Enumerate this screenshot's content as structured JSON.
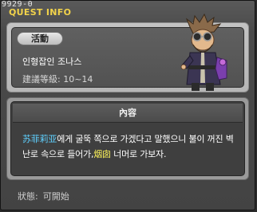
{
  "quest_id": "9929-0",
  "window_title": "QUEST INFO",
  "tag_label": "活動",
  "npc_name": "인형잡인 조나스",
  "level_label": "建議等級:",
  "level_range": "10~14",
  "content_header": "內容",
  "description": {
    "part1_highlight": "苏菲莉亚",
    "part2": "에게 굴뚝 쪽으로 가겠다고 말했으니 불이 꺼진 벽난로 속으로 들어가,",
    "part3_highlight": "烟囱",
    "part4": " 너머로 가보자."
  },
  "status_label": "狀態:",
  "status_value": "可開始",
  "colors": {
    "title": "#f2d34a",
    "highlight_blue": "#5fd0ff",
    "highlight_yellow": "#fff45a"
  }
}
